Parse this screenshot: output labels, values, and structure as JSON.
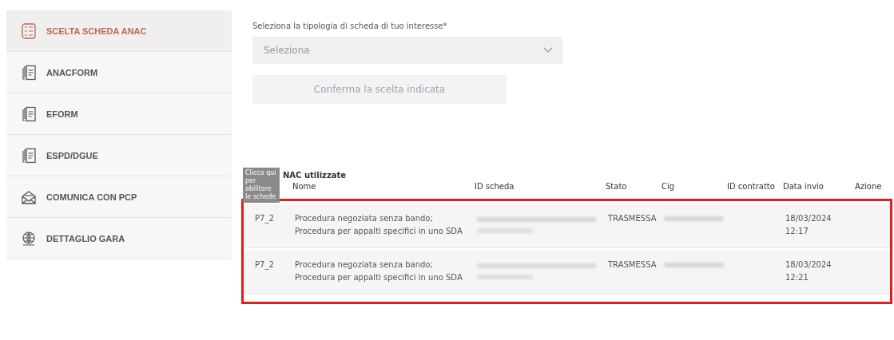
{
  "sidebar": {
    "items": [
      {
        "label": "SCELTA SCHEDA ANAC",
        "kind": "checklist",
        "selected": true
      },
      {
        "label": "ANACFORM",
        "kind": "documents",
        "selected": false
      },
      {
        "label": "EFORM",
        "kind": "documents",
        "selected": false
      },
      {
        "label": "ESPD/DGUE",
        "kind": "documents",
        "selected": false
      },
      {
        "label": "COMUNICA CON PCP",
        "kind": "envelope",
        "selected": false
      },
      {
        "label": "DETTAGLIO GARA",
        "kind": "globe",
        "selected": false
      }
    ]
  },
  "form": {
    "label": "Seleziona la tipologia di scheda di tuo interesse*",
    "select": {
      "placeholder": "Seleziona"
    },
    "confirm_button": {
      "label": "Conferma la scelta indicata",
      "disabled": true
    }
  },
  "table": {
    "heading": "NAC utilizzate",
    "tooltip": "Clicca qui per abilitare le schede",
    "columns": [
      "Nome",
      "ID scheda",
      "Stato",
      "Cig",
      "ID contratto",
      "Data invio",
      "Azione"
    ],
    "highlighted": true,
    "rows": [
      {
        "code": "P7_2",
        "nome": "Procedura negoziata senza bando; Procedura per appalti specifici in uno SDA",
        "id_redacted": true,
        "stato": "TRASMESSA",
        "cig_redacted": true,
        "data_invio": "18/03/2024 12:17"
      },
      {
        "code": "P7_2",
        "nome": "Procedura negoziata senza bando; Procedura per appalti specifici in uno SDA",
        "id_redacted": true,
        "stato": "TRASMESSA",
        "cig_redacted": true,
        "data_invio": "18/03/2024 12:21"
      }
    ]
  }
}
